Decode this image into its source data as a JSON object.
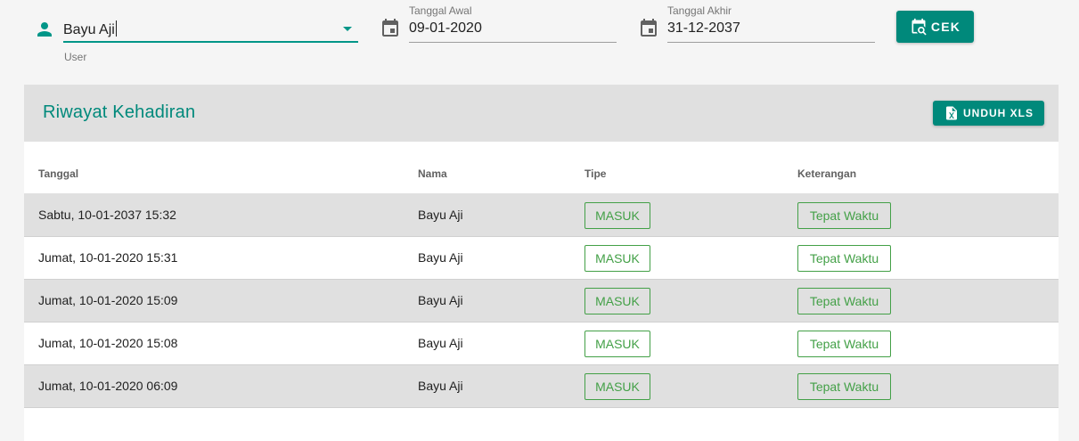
{
  "filters": {
    "user": {
      "value": "Bayu Aji",
      "hint": "User",
      "icon": "person-icon"
    },
    "start_date": {
      "label": "Tanggal Awal",
      "value": "09-01-2020",
      "icon": "calendar-icon"
    },
    "end_date": {
      "label": "Tanggal Akhir",
      "value": "31-12-2037",
      "icon": "calendar-icon"
    },
    "check_button": {
      "label": "CEK",
      "icon": "calendar-search-icon"
    }
  },
  "card": {
    "title": "Riwayat Kehadiran",
    "download_button": {
      "label": "UNDUH XLS",
      "icon": "excel-file-icon"
    }
  },
  "table": {
    "columns": [
      "Tanggal",
      "Nama",
      "Tipe",
      "Keterangan"
    ],
    "rows": [
      {
        "tanggal": "Sabtu, 10-01-2037 15:32",
        "nama": "Bayu Aji",
        "tipe": "MASUK",
        "keterangan": "Tepat Waktu"
      },
      {
        "tanggal": "Jumat, 10-01-2020 15:31",
        "nama": "Bayu Aji",
        "tipe": "MASUK",
        "keterangan": "Tepat Waktu"
      },
      {
        "tanggal": "Jumat, 10-01-2020 15:09",
        "nama": "Bayu Aji",
        "tipe": "MASUK",
        "keterangan": "Tepat Waktu"
      },
      {
        "tanggal": "Jumat, 10-01-2020 15:08",
        "nama": "Bayu Aji",
        "tipe": "MASUK",
        "keterangan": "Tepat Waktu"
      },
      {
        "tanggal": "Jumat, 10-01-2020 06:09",
        "nama": "Bayu Aji",
        "tipe": "MASUK",
        "keterangan": "Tepat Waktu"
      }
    ]
  },
  "colors": {
    "primary": "#00897b",
    "chip_green": "#43a047",
    "header_bg": "#e0e0e0",
    "page_bg": "#f5f5f5"
  }
}
